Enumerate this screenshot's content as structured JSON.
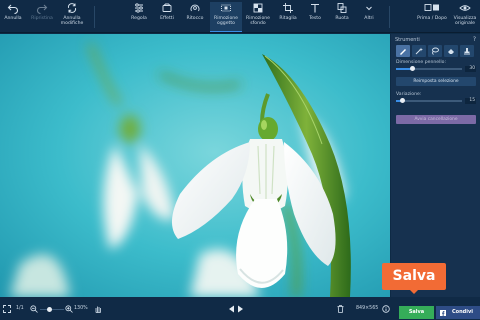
{
  "toolbar": {
    "undo": "Annulla",
    "redo": "Ripristina",
    "undo_changes": "Annulla\nmodifiche",
    "adjust": "Regola",
    "effects": "Effetti",
    "retouch": "Ritocco",
    "remove_object": "Rimozione\noggetto",
    "remove_bg": "Rimozione\nsfondo",
    "crop": "Ritaglia",
    "text": "Testo",
    "rotate": "Ruota",
    "more": "Altri",
    "before_after": "Prima / Dopo",
    "view_original": "Visualizza\noriginale"
  },
  "panel": {
    "title": "Strumenti",
    "help": "?",
    "brush_size_label": "Dimensione pennello:",
    "brush_size_value": "30",
    "brush_size_fraction": 0.25,
    "reset_selection": "Reimposta selezione",
    "variation_label": "Variazione:",
    "variation_value": "15",
    "variation_fraction": 0.1,
    "start_erase": "Avvia cancellazione"
  },
  "status": {
    "page": "1/1",
    "zoom": "130%",
    "dimensions": "849×565",
    "zoom_fraction": 0.4
  },
  "actions": {
    "save": "Salva",
    "share": "Condivi",
    "save_callout": "Salva"
  },
  "colors": {
    "toolbar_bg": "#102a46",
    "accent": "#3a8ee6",
    "save_green": "#35ad59",
    "callout_orange": "#f26b35"
  }
}
